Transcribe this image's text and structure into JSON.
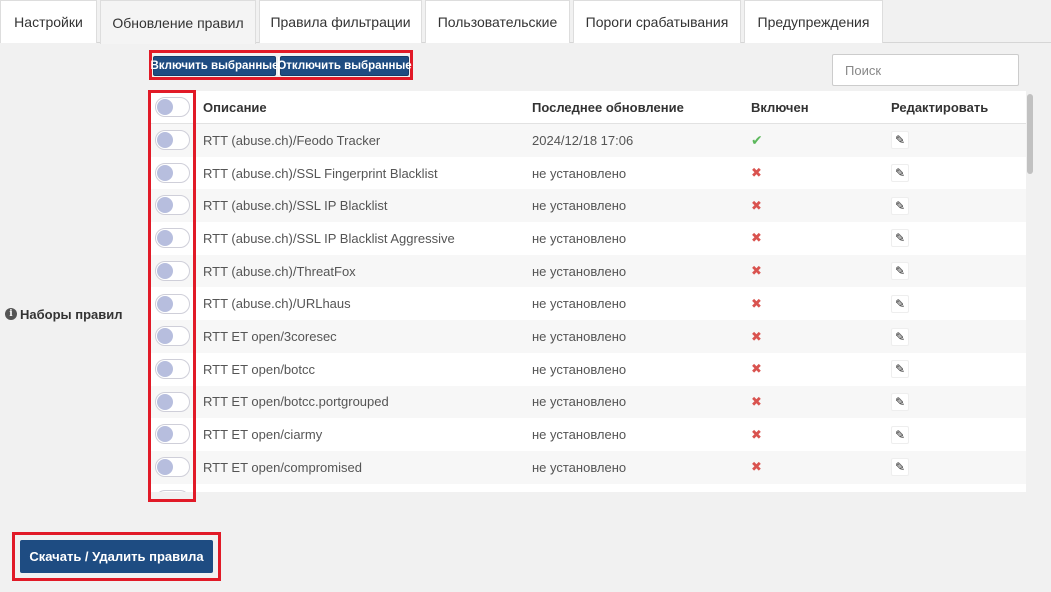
{
  "tabs": [
    {
      "label": "Настройки",
      "active": false
    },
    {
      "label": "Обновление правил",
      "active": true
    },
    {
      "label": "Правила фильтрации",
      "active": false
    },
    {
      "label": "Пользовательские",
      "active": false
    },
    {
      "label": "Пороги срабатывания",
      "active": false
    },
    {
      "label": "Предупреждения",
      "active": false
    }
  ],
  "toolbar": {
    "enable_selected": "Включить выбранные",
    "disable_selected": "Отключить выбранные"
  },
  "search": {
    "placeholder": "Поиск",
    "value": ""
  },
  "section": {
    "label": "Наборы правил"
  },
  "table": {
    "columns": {
      "description": "Описание",
      "last_update": "Последнее обновление",
      "enabled": "Включен",
      "edit": "Редактировать"
    },
    "rows": [
      {
        "description": "RTT (abuse.ch)/Feodo Tracker",
        "last_update": "2024/12/18 17:06",
        "enabled": true
      },
      {
        "description": "RTT (abuse.ch)/SSL Fingerprint Blacklist",
        "last_update": "не установлено",
        "enabled": false
      },
      {
        "description": "RTT (abuse.ch)/SSL IP Blacklist",
        "last_update": "не установлено",
        "enabled": false
      },
      {
        "description": "RTT (abuse.ch)/SSL IP Blacklist Aggressive",
        "last_update": "не установлено",
        "enabled": false
      },
      {
        "description": "RTT (abuse.ch)/ThreatFox",
        "last_update": "не установлено",
        "enabled": false
      },
      {
        "description": "RTT (abuse.ch)/URLhaus",
        "last_update": "не установлено",
        "enabled": false
      },
      {
        "description": "RTT ET open/3coresec",
        "last_update": "не установлено",
        "enabled": false
      },
      {
        "description": "RTT ET open/botcc",
        "last_update": "не установлено",
        "enabled": false
      },
      {
        "description": "RTT ET open/botcc.portgrouped",
        "last_update": "не установлено",
        "enabled": false
      },
      {
        "description": "RTT ET open/ciarmy",
        "last_update": "не установлено",
        "enabled": false
      },
      {
        "description": "RTT ET open/compromised",
        "last_update": "не установлено",
        "enabled": false
      }
    ]
  },
  "footer": {
    "download_button": "Скачать / Удалить правила"
  },
  "colors": {
    "primary": "#1e4c82",
    "highlight": "#e11a27",
    "enabled_check": "#5cb85c",
    "disabled_cross": "#d9534f"
  },
  "icons": {
    "enabled": "check-icon",
    "disabled": "cross-icon",
    "edit": "pencil-icon",
    "info": "info-icon"
  }
}
